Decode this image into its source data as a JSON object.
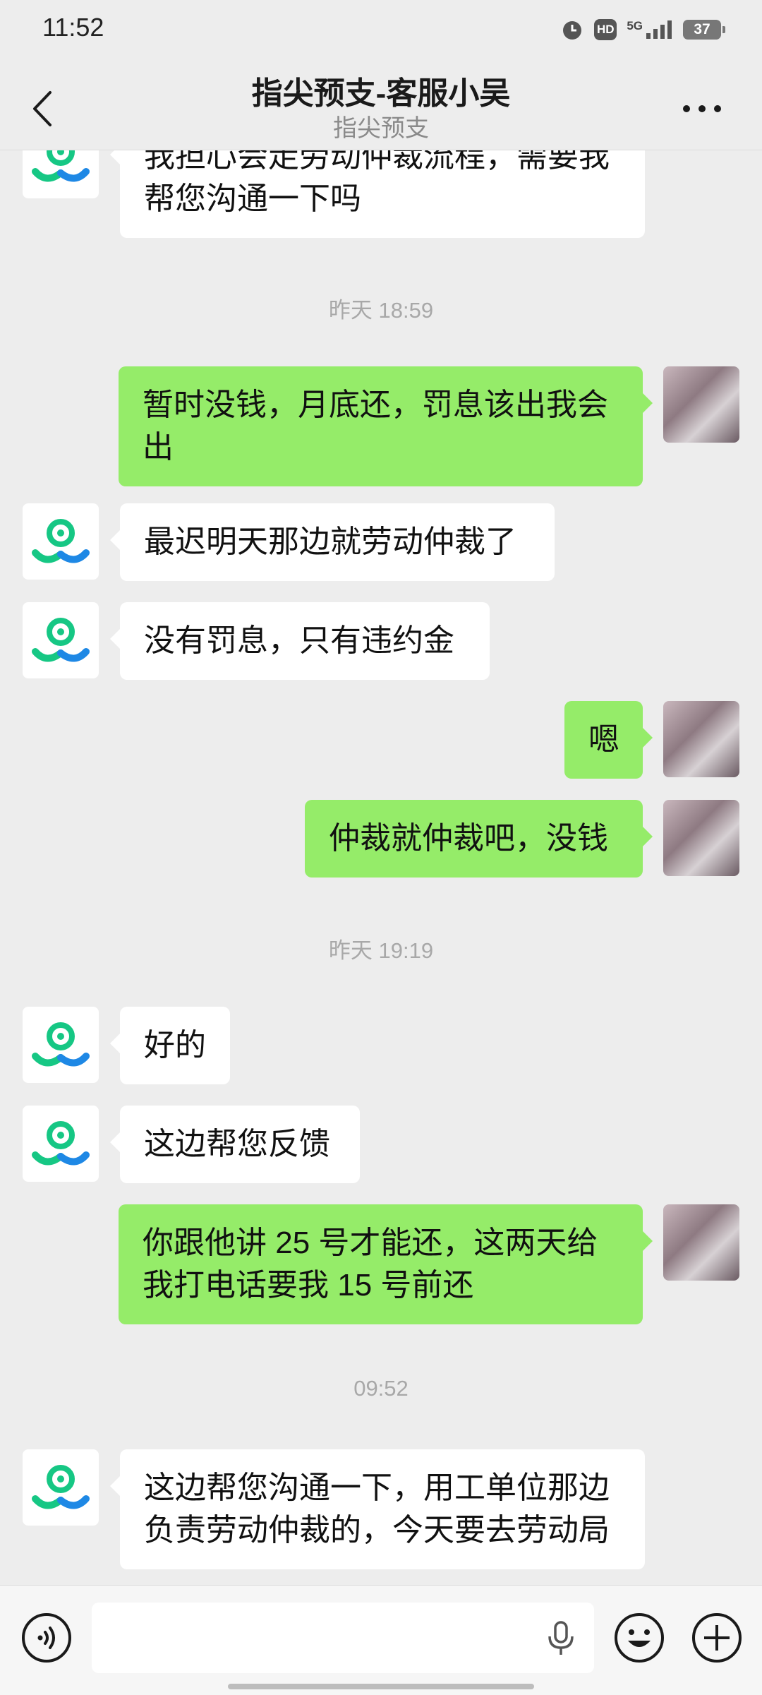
{
  "status_bar": {
    "time": "11:52",
    "hd": "HD",
    "network": "5G",
    "battery": "37"
  },
  "header": {
    "title": "指尖预支-客服小吴",
    "subtitle": "指尖预支"
  },
  "messages": [
    {
      "type": "in",
      "text": "我担心会走劳动仲裁流程，需要我帮您沟通一下吗"
    },
    {
      "type": "time",
      "text": "昨天 18:59"
    },
    {
      "type": "out",
      "text": "暂时没钱，月底还，罚息该出我会出"
    },
    {
      "type": "in",
      "text": "最迟明天那边就劳动仲裁了"
    },
    {
      "type": "in",
      "text": "没有罚息，只有违约金"
    },
    {
      "type": "out",
      "text": "嗯"
    },
    {
      "type": "out",
      "text": "仲裁就仲裁吧，没钱"
    },
    {
      "type": "time",
      "text": "昨天 19:19"
    },
    {
      "type": "in",
      "text": "好的"
    },
    {
      "type": "in",
      "text": "这边帮您反馈"
    },
    {
      "type": "out",
      "text": "你跟他讲 25 号才能还，这两天给我打电话要我 15 号前还"
    },
    {
      "type": "time",
      "text": "09:52"
    },
    {
      "type": "in",
      "text": "这边帮您沟通一下，用工单位那边负责劳动仲裁的，今天要去劳动局"
    }
  ],
  "input_bar": {
    "placeholder": ""
  },
  "colors": {
    "background": "#ededed",
    "outgoing_bubble": "#95ec69",
    "incoming_bubble": "#ffffff",
    "bot_logo_green": "#16c784",
    "bot_logo_blue": "#1e88e5"
  },
  "icons": [
    "back-arrow-icon",
    "more-icon",
    "voice-icon",
    "mic-icon",
    "emoji-icon",
    "plus-icon",
    "bot-logo-icon"
  ]
}
